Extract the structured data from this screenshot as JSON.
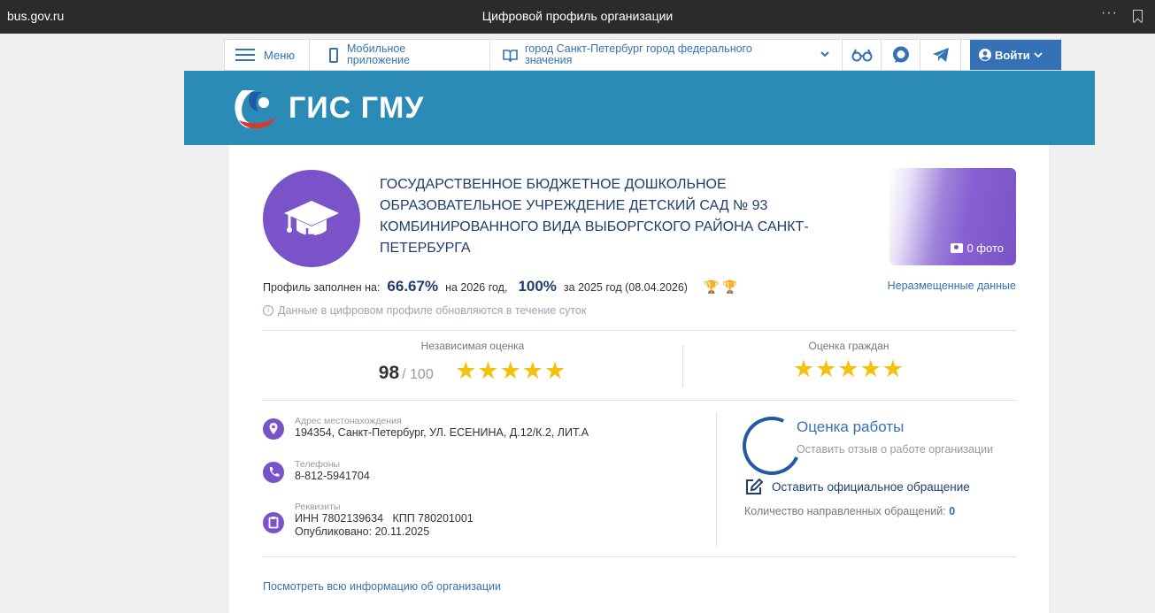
{
  "browser": {
    "domain": "bus.gov.ru",
    "title": "Цифровой профиль организации",
    "dots": "···"
  },
  "nav": {
    "menu_label": "Меню",
    "mobile_line1": "Мобильное",
    "mobile_line2": "приложение",
    "region_line1": "город Санкт-Петербург город федерального",
    "region_line2": "значения",
    "login_label": "Войти"
  },
  "banner": {
    "logo_text": "ГИС ГМУ"
  },
  "org": {
    "name": "ГОСУДАРСТВЕННОЕ БЮДЖЕТНОЕ ДОШКОЛЬНОЕ ОБРАЗОВАТЕЛЬНОЕ УЧРЕЖДЕНИЕ ДЕТСКИЙ САД № 93 КОМБИНИРОВАННОГО ВИДА ВЫБОРГСКОГО РАЙОНА САНКТ-ПЕТЕРБУРГА",
    "photo_label": "0 фото"
  },
  "profile": {
    "filled_label": "Профиль заполнен на:",
    "pct_2026": "66.67%",
    "label_2026": "на 2026 год,",
    "pct_2025": "100%",
    "label_2025": "за 2025 год (08.04.2026)",
    "trophies": "🏆🏆",
    "unplaced_link": "Неразмещенные данные",
    "update_note": "Данные в цифровом профиле обновляются в течение суток"
  },
  "ratings": {
    "independent_label": "Независимая оценка",
    "independent_score": "98",
    "independent_max": "/ 100",
    "independent_stars": "★★★★★",
    "citizens_label": "Оценка граждан",
    "citizens_stars": "★★★★★"
  },
  "contacts": {
    "address_label": "Адрес местонахождения",
    "address": "194354, Санкт-Петербург, УЛ. ЕСЕНИНА, Д.12/К.2, ЛИТ.А",
    "phones_label": "Телефоны",
    "phone": "8-812-5941704",
    "requisites_label": "Реквизиты",
    "inn": "ИНН 7802139634",
    "kpp": "КПП 780201001",
    "published": "Опубликовано: 20.11.2025"
  },
  "work": {
    "title": "Оценка работы",
    "subtitle": "Оставить отзыв о работе организации",
    "appeal_link": "Оставить официальное обращение",
    "appeal_count_label": "Количество направленных обращений:",
    "appeal_count": "0"
  },
  "footer": {
    "all_info_link": "Посмотреть всю информацию об организации"
  },
  "colors": {
    "brand_blue": "#3471b7",
    "banner": "#2b8bb7",
    "purple": "#7b53c8",
    "star": "#f4c20d"
  }
}
